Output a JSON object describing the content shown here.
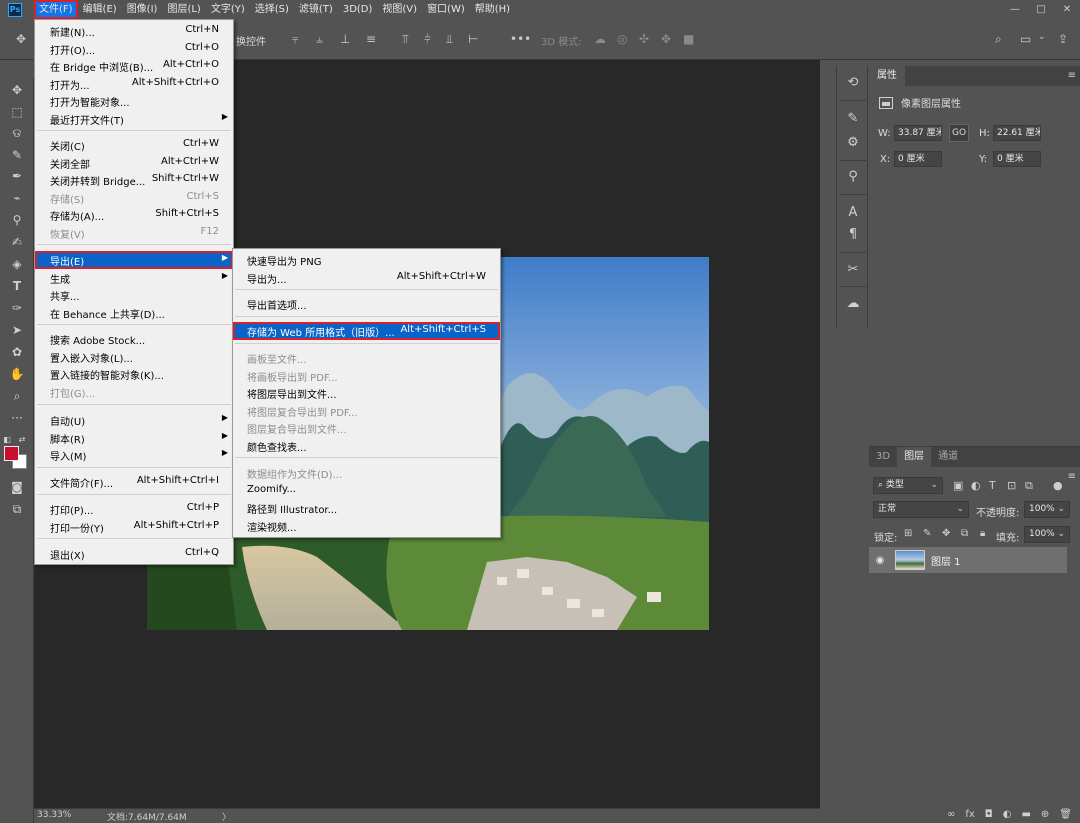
{
  "app": {
    "logo": "Ps"
  },
  "menubar": {
    "items": [
      {
        "label": "文件(F)",
        "active": true
      },
      {
        "label": "编辑(E)"
      },
      {
        "label": "图像(I)"
      },
      {
        "label": "图层(L)"
      },
      {
        "label": "文字(Y)"
      },
      {
        "label": "选择(S)"
      },
      {
        "label": "滤镜(T)"
      },
      {
        "label": "3D(D)"
      },
      {
        "label": "视图(V)"
      },
      {
        "label": "窗口(W)"
      },
      {
        "label": "帮助(H)"
      }
    ],
    "window_buttons": [
      "minimize",
      "restore",
      "close"
    ]
  },
  "optionsbar": {
    "label": "换控件",
    "mode_3d": "3D 模式:"
  },
  "file_menu": {
    "items": [
      {
        "label": "新建(N)...",
        "shortcut": "Ctrl+N"
      },
      {
        "label": "打开(O)...",
        "shortcut": "Ctrl+O"
      },
      {
        "label": "在 Bridge 中浏览(B)...",
        "shortcut": "Alt+Ctrl+O"
      },
      {
        "label": "打开为...",
        "shortcut": "Alt+Shift+Ctrl+O"
      },
      {
        "label": "打开为智能对象..."
      },
      {
        "label": "最近打开文件(T)",
        "submenu": true
      },
      {
        "label": "关闭(C)",
        "shortcut": "Ctrl+W"
      },
      {
        "label": "关闭全部",
        "shortcut": "Alt+Ctrl+W"
      },
      {
        "label": "关闭并转到 Bridge...",
        "shortcut": "Shift+Ctrl+W"
      },
      {
        "label": "存储(S)",
        "shortcut": "Ctrl+S",
        "disabled": true
      },
      {
        "label": "存储为(A)...",
        "shortcut": "Shift+Ctrl+S"
      },
      {
        "label": "恢复(V)",
        "shortcut": "F12",
        "disabled": true
      },
      {
        "label": "导出(E)",
        "submenu": true,
        "highlighted": true
      },
      {
        "label": "生成",
        "submenu": true
      },
      {
        "label": "共享..."
      },
      {
        "label": "在 Behance 上共享(D)..."
      },
      {
        "label": "搜索 Adobe Stock..."
      },
      {
        "label": "置入嵌入对象(L)..."
      },
      {
        "label": "置入链接的智能对象(K)..."
      },
      {
        "label": "打包(G)...",
        "disabled": true
      },
      {
        "label": "自动(U)",
        "submenu": true
      },
      {
        "label": "脚本(R)",
        "submenu": true
      },
      {
        "label": "导入(M)",
        "submenu": true
      },
      {
        "label": "文件简介(F)...",
        "shortcut": "Alt+Shift+Ctrl+I"
      },
      {
        "label": "打印(P)...",
        "shortcut": "Ctrl+P"
      },
      {
        "label": "打印一份(Y)",
        "shortcut": "Alt+Shift+Ctrl+P"
      },
      {
        "label": "退出(X)",
        "shortcut": "Ctrl+Q"
      }
    ]
  },
  "export_menu": {
    "items": [
      {
        "label": "快速导出为 PNG"
      },
      {
        "label": "导出为...",
        "shortcut": "Alt+Shift+Ctrl+W"
      },
      {
        "label": "导出首选项..."
      },
      {
        "label": "存储为 Web 所用格式（旧版）...",
        "shortcut": "Alt+Shift+Ctrl+S",
        "highlighted": true
      },
      {
        "label": "画板至文件...",
        "disabled": true
      },
      {
        "label": "将画板导出到 PDF...",
        "disabled": true
      },
      {
        "label": "将图层导出到文件..."
      },
      {
        "label": "将图层复合导出到 PDF...",
        "disabled": true
      },
      {
        "label": "图层复合导出到文件...",
        "disabled": true
      },
      {
        "label": "颜色查找表..."
      },
      {
        "label": "数据组作为文件(D)...",
        "disabled": true
      },
      {
        "label": "Zoomify..."
      },
      {
        "label": "路径到 Illustrator..."
      },
      {
        "label": "渲染视频..."
      }
    ]
  },
  "properties": {
    "tab": "属性",
    "title": "像素图层属性",
    "w_label": "W:",
    "w_value": "33.87 厘米",
    "h_label": "H:",
    "h_value": "22.61 厘米",
    "x_label": "X:",
    "x_value": "0 厘米",
    "y_label": "Y:",
    "y_value": "0 厘米",
    "link": "GO"
  },
  "layers": {
    "tabs": [
      {
        "label": "3D"
      },
      {
        "label": "图层",
        "active": true
      },
      {
        "label": "通道"
      }
    ],
    "filter": "类型",
    "blend_mode": "正常",
    "opacity_label": "不透明度:",
    "opacity_value": "100%",
    "lock_label": "锁定:",
    "fill_label": "填充:",
    "fill_value": "100%",
    "layer_name": "图层 1"
  },
  "status": {
    "zoom": "33.33%",
    "doc": "文档:7.64M/7.64M",
    "arrow": "〉"
  },
  "colors": {
    "foreground": "#c8102e",
    "background": "#ffffff",
    "highlight": "#0a64c8",
    "annotation_border": "#d9212c"
  },
  "icons": {
    "toolbar": [
      "move-icon",
      "marquee-icon",
      "lasso-icon",
      "quick-select-icon",
      "crop-icon",
      "eyedropper-icon",
      "healing-brush-icon",
      "brush-icon",
      "clone-stamp-icon",
      "history-brush-icon",
      "eraser-icon",
      "gradient-icon",
      "blur-icon",
      "dodge-icon",
      "pen-icon",
      "type-icon",
      "path-select-icon",
      "shape-icon",
      "hand-icon",
      "zoom-icon",
      "more-tools-icon"
    ]
  }
}
